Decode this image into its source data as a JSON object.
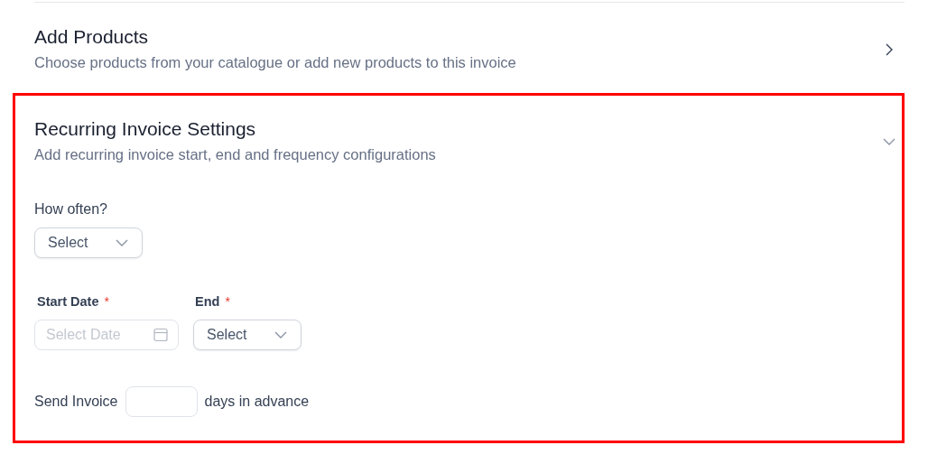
{
  "sections": [
    {
      "title": "Add Products",
      "subtitle": "Choose products from your catalogue or add new products to this invoice",
      "expanded": false,
      "highlighted": false
    },
    {
      "title": "Recurring Invoice Settings",
      "subtitle": "Add recurring invoice start, end and frequency configurations",
      "expanded": true,
      "highlighted": true,
      "form": {
        "frequency": {
          "label": "How often?",
          "value": "Select"
        },
        "start_date": {
          "label": "Start Date",
          "required_mark": "*",
          "placeholder": "Select Date"
        },
        "end": {
          "label": "End",
          "required_mark": "*",
          "value": "Select"
        },
        "advance": {
          "prefix": "Send Invoice",
          "suffix": "days in advance"
        }
      }
    }
  ]
}
